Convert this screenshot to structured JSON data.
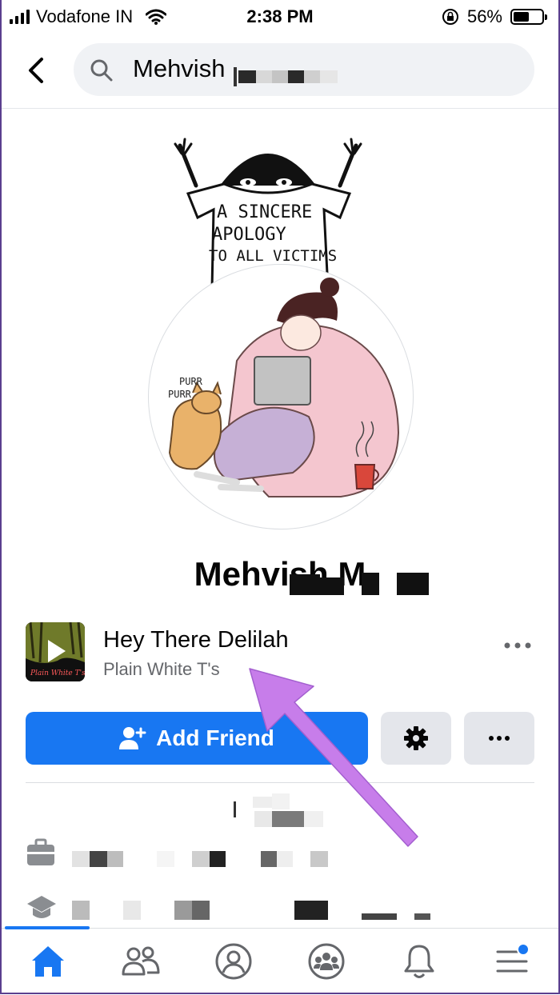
{
  "status_bar": {
    "carrier": "Vodafone IN",
    "time": "2:38 PM",
    "battery_percent": "56%",
    "battery_level": 0.56
  },
  "search": {
    "query": "Mehvish"
  },
  "cover": {
    "shirt_text": [
      "A SINCERE",
      "APOLOGY",
      "TO ALL VICTIMS"
    ]
  },
  "profile_picture": {
    "caption_line1": "PURR",
    "caption_line2": "PURR"
  },
  "profile": {
    "name": "Mehvish M"
  },
  "music": {
    "title": "Hey There Delilah",
    "artist": "Plain White T's",
    "more_icon": "ellipsis-icon",
    "album_label": "Plain White T's"
  },
  "actions": {
    "add_friend_label": "Add Friend",
    "settings_icon": "gear-icon",
    "more_icon": "ellipsis-icon"
  },
  "about": {
    "work_icon": "briefcase-icon",
    "education_icon": "graduation-cap-icon"
  },
  "bottom_nav": {
    "items": [
      "home-icon",
      "friends-icon",
      "profile-icon",
      "groups-icon",
      "bell-icon",
      "menu-icon"
    ],
    "active_color": "#1877f2"
  },
  "colors": {
    "accent": "#1877f2",
    "annotation_arrow": "#c77dea"
  }
}
